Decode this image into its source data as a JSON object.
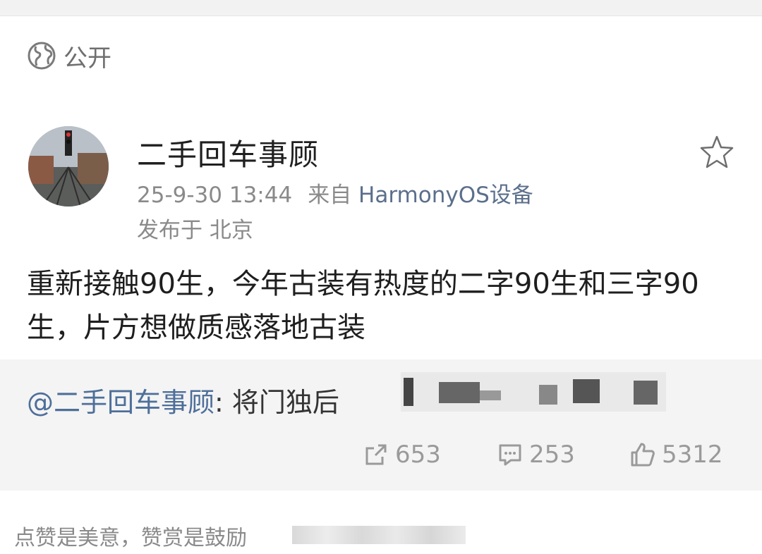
{
  "header": {
    "visibility_label": "公开"
  },
  "post": {
    "username": "二手回车事顾",
    "timestamp": "25-9-30 13:44",
    "source_prefix": "来自",
    "source_device": "HarmonyOS设备",
    "location": "发布于 北京",
    "content": "重新接触90生，今年古装有热度的二字90生和三字90生，片方想做质感落地古装"
  },
  "repost": {
    "mention": "@二手回车事顾",
    "text": ": 将门独后"
  },
  "stats": {
    "share": "653",
    "comment": "253",
    "like": "5312"
  },
  "footer": {
    "text": "点赞是美意，赞赏是鼓励"
  },
  "colors": {
    "accent": "#4e6f9a",
    "secondary_text": "#8a8a8a",
    "repost_bg": "#f4f4f4"
  }
}
